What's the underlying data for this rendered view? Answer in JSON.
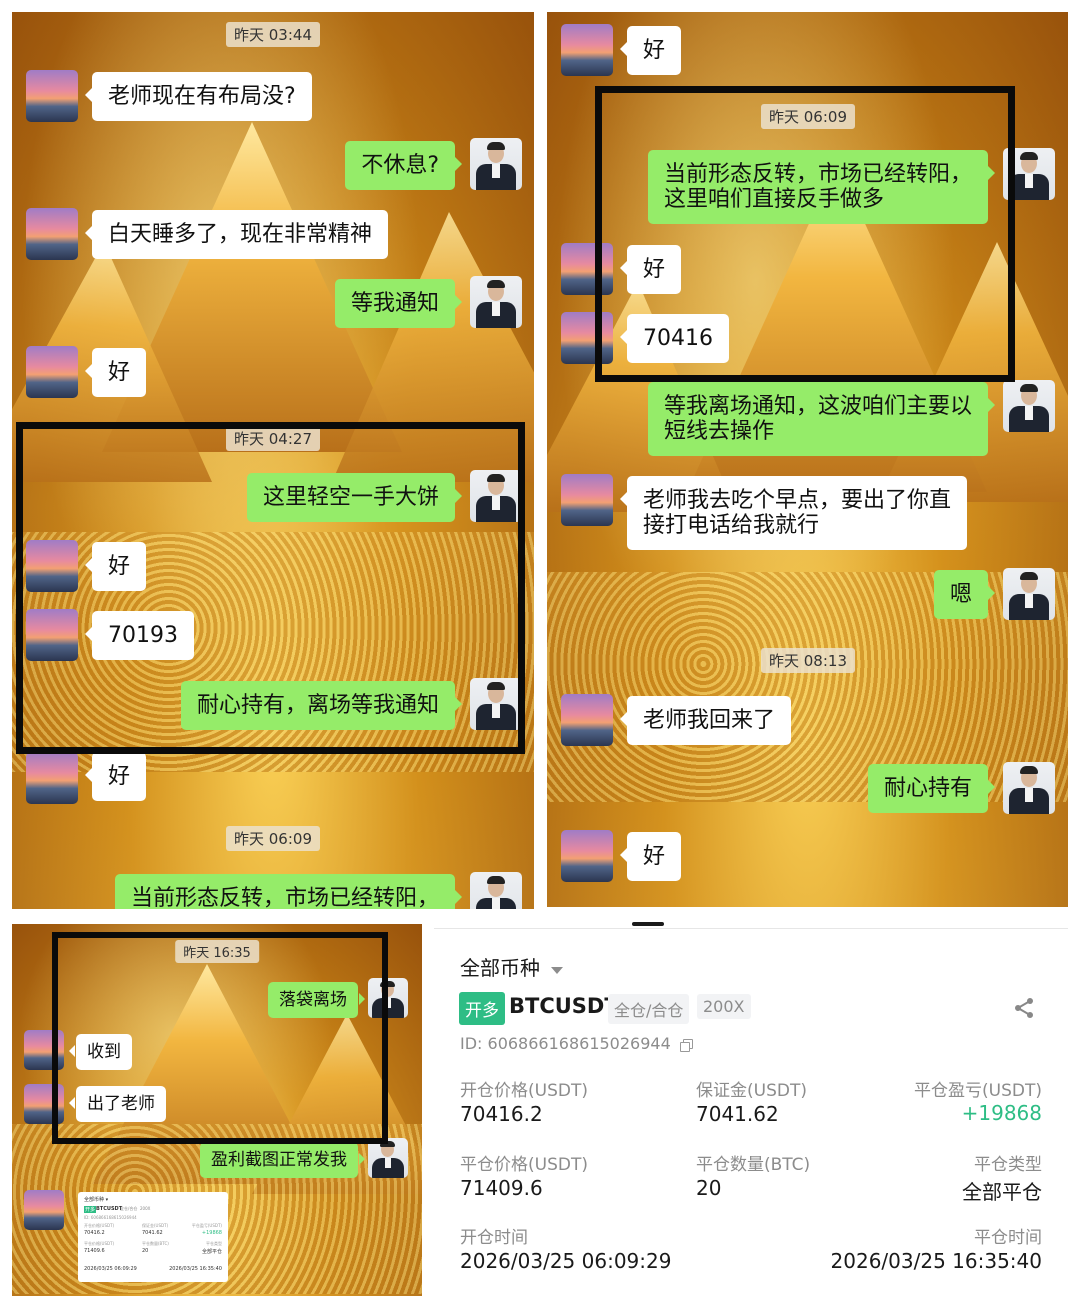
{
  "panel1": {
    "times": [
      "昨天 03:44",
      "昨天 04:27",
      "昨天 06:09"
    ],
    "messages": [
      {
        "side": "in",
        "text": "老师现在有布局没?"
      },
      {
        "side": "out",
        "text": "不休息?"
      },
      {
        "side": "in",
        "text": "白天睡多了，现在非常精神"
      },
      {
        "side": "out",
        "text": "等我通知"
      },
      {
        "side": "in",
        "text": "好"
      },
      {
        "side": "out",
        "text": "这里轻空一手大饼"
      },
      {
        "side": "in",
        "text": "好"
      },
      {
        "side": "in",
        "text": "70193"
      },
      {
        "side": "out",
        "text": "耐心持有，离场等我通知"
      },
      {
        "side": "in",
        "text": "好"
      },
      {
        "side": "out",
        "text": "当前形态反转，市场已经转阳，"
      }
    ]
  },
  "panel2": {
    "times": [
      "昨天 06:09",
      "昨天 08:13"
    ],
    "messages": [
      {
        "side": "in",
        "text": "好"
      },
      {
        "side": "out",
        "text": "当前形态反转，市场已经转阳，\n这里咱们直接反手做多"
      },
      {
        "side": "in",
        "text": "好"
      },
      {
        "side": "in",
        "text": "70416"
      },
      {
        "side": "out",
        "text": "等我离场通知，这波咱们主要以\n短线去操作"
      },
      {
        "side": "in",
        "text": "老师我去吃个早点，要出了你直\n接打电话给我就行"
      },
      {
        "side": "out",
        "text": "嗯"
      },
      {
        "side": "in",
        "text": "老师我回来了"
      },
      {
        "side": "out",
        "text": "耐心持有"
      },
      {
        "side": "in",
        "text": "好"
      }
    ]
  },
  "panel3": {
    "time": "昨天 16:35",
    "messages": [
      {
        "side": "out",
        "text": "落袋离场"
      },
      {
        "side": "in",
        "text": "收到"
      },
      {
        "side": "in",
        "text": "出了老师"
      },
      {
        "side": "out",
        "text": "盈利截图正常发我"
      }
    ],
    "mini": {
      "filter": "全部币种 ▾",
      "badge": "开多",
      "symbol": "BTCUSDT",
      "mode": "全仓/合仓",
      "lev": "200X",
      "id": "ID: 606866168615026944",
      "l1": "开仓价格(USDT)",
      "v1": "70416.2",
      "l2": "保证金(USDT)",
      "v2": "7041.62",
      "l3": "平仓盈亏(USDT)",
      "v3": "+19868",
      "l4": "平仓价格(USDT)",
      "v4": "71409.6",
      "l5": "平仓数量(BTC)",
      "v5": "20",
      "l6": "平仓类型",
      "v6": "全部平仓",
      "t1": "2026/03/25 06:09:29",
      "t2": "2026/03/25 16:35:40"
    }
  },
  "trade": {
    "filter": "全部币种",
    "side_badge": "开多",
    "symbol": "BTCUSDT",
    "margin_mode": "全仓/合仓",
    "leverage": "200X",
    "order_id": "ID: 606866168615026944",
    "open_price_label": "开仓价格(USDT)",
    "open_price": "70416.2",
    "margin_label": "保证金(USDT)",
    "margin": "7041.62",
    "pnl_label": "平仓盈亏(USDT)",
    "pnl": "+19868",
    "close_price_label": "平仓价格(USDT)",
    "close_price": "71409.6",
    "close_qty_label": "平仓数量(BTC)",
    "close_qty": "20",
    "close_type_label": "平仓类型",
    "close_type": "全部平仓",
    "open_time_label": "开仓时间",
    "open_time": "2026/03/25 06:09:29",
    "close_time_label": "平仓时间",
    "close_time": "2026/03/25 16:35:40",
    "colors": {
      "green": "#2ebd85",
      "badge_bg": "#2ebd85",
      "chip_bg": "#f2f3f5"
    },
    "icons": [
      "chevron-down-icon",
      "copy-icon",
      "share-icon"
    ]
  }
}
